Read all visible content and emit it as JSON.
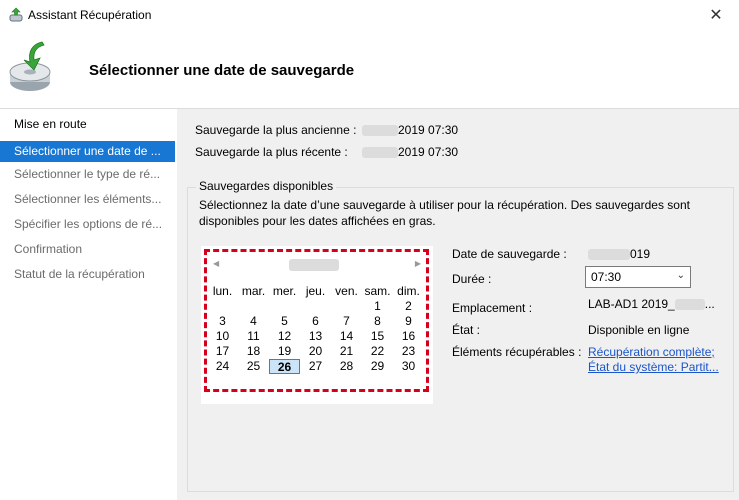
{
  "window": {
    "title": "Assistant Récupération",
    "close_icon": "close-icon"
  },
  "header": {
    "title": "Sélectionner une date de sauvegarde",
    "icon": "backup-restore-icon"
  },
  "sidebar": {
    "items": [
      {
        "label": "Mise en route"
      },
      {
        "label": "Sélectionner une date de ..."
      },
      {
        "label": "Sélectionner le type de ré..."
      },
      {
        "label": "Sélectionner les éléments..."
      },
      {
        "label": "Spécifier les options de ré..."
      },
      {
        "label": "Confirmation"
      },
      {
        "label": "Statut de la récupération"
      }
    ],
    "active_index": 1
  },
  "backups": {
    "oldest_label": "Sauvegarde la plus ancienne :",
    "oldest_value": "2019 07:30",
    "newest_label": "Sauvegarde la plus récente :",
    "newest_value": "2019 07:30"
  },
  "available": {
    "legend": "Sauvegardes disponibles",
    "description": "Sélectionnez la date d’une sauvegarde à utiliser pour la récupération. Des sauvegardes sont disponibles pour les dates affichées en gras."
  },
  "calendar": {
    "weekdays": [
      "lun.",
      "mar.",
      "mer.",
      "jeu.",
      "ven.",
      "sam.",
      "dim."
    ],
    "weeks": [
      [
        "",
        "",
        "",
        "",
        "",
        "1",
        "2"
      ],
      [
        "3",
        "4",
        "5",
        "6",
        "7",
        "8",
        "9"
      ],
      [
        "10",
        "11",
        "12",
        "13",
        "14",
        "15",
        "16"
      ],
      [
        "17",
        "18",
        "19",
        "20",
        "21",
        "22",
        "23"
      ],
      [
        "24",
        "25",
        "26",
        "27",
        "28",
        "29",
        "30"
      ]
    ],
    "selected_day": "26",
    "prev_glyph": "◀",
    "next_glyph": "▶"
  },
  "details": {
    "date_label": "Date de sauvegarde :",
    "date_value": "019",
    "time_label": "Durée :",
    "time_value": "07:30",
    "location_label": "Emplacement :",
    "location_value": "LAB-AD1 2019_",
    "location_suffix": "...",
    "state_label": "État :",
    "state_value": "Disponible en ligne",
    "items_label": "Éléments récupérables :",
    "items": [
      "Récupération complète;",
      "État du système: Partit..."
    ]
  }
}
